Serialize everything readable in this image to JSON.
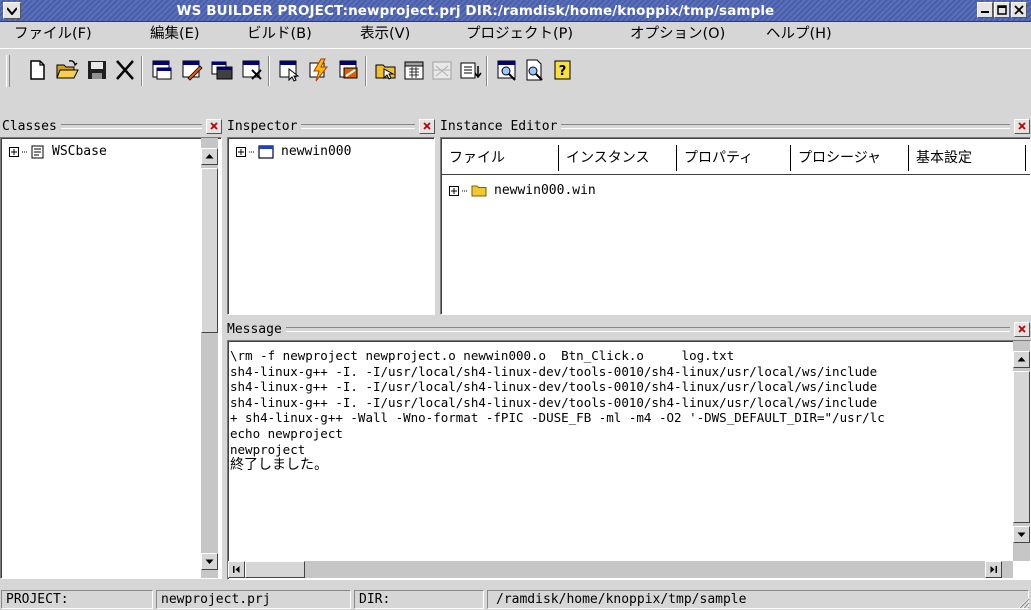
{
  "window": {
    "title": "WS BUILDER PROJECT:newproject.prj DIR:/ramdisk/home/knoppix/tmp/sample"
  },
  "menu": [
    {
      "label": "ファイル(F)"
    },
    {
      "label": "編集(E)"
    },
    {
      "label": "ビルド(B)"
    },
    {
      "label": "表示(V)"
    },
    {
      "label": "プロジェクト(P)"
    },
    {
      "label": "オプション(O)"
    },
    {
      "label": "ヘルプ(H)"
    }
  ],
  "toolbar_icons": [
    "new-file",
    "open-folder",
    "save",
    "delete",
    "dialog-1",
    "dialog-2",
    "dialog-3",
    "dialog-4",
    "dialog-5",
    "lightning",
    "dialog-6",
    "folder-arrow",
    "calendar",
    "gray-grid",
    "list-arrow",
    "find-window",
    "preview",
    "help"
  ],
  "classes_panel": {
    "title": "Classes",
    "items": [
      {
        "label": "WSCbase"
      }
    ]
  },
  "inspector_panel": {
    "title": "Inspector",
    "items": [
      {
        "label": "newwin000"
      }
    ]
  },
  "instance_editor": {
    "title": "Instance Editor",
    "tabs": [
      {
        "label": "ファイル"
      },
      {
        "label": "インスタンス"
      },
      {
        "label": "プロパティ"
      },
      {
        "label": "プロシージャ"
      },
      {
        "label": "基本設定"
      }
    ],
    "items": [
      {
        "label": "newwin000.win"
      }
    ]
  },
  "message_panel": {
    "title": "Message",
    "lines": [
      "\\rm -f newproject newproject.o newwin000.o  Btn_Click.o     log.txt",
      "sh4-linux-g++ -I. -I/usr/local/sh4-linux-dev/tools-0010/sh4-linux/usr/local/ws/include",
      "sh4-linux-g++ -I. -I/usr/local/sh4-linux-dev/tools-0010/sh4-linux/usr/local/ws/include",
      "sh4-linux-g++ -I. -I/usr/local/sh4-linux-dev/tools-0010/sh4-linux/usr/local/ws/include",
      "+ sh4-linux-g++ -Wall -Wno-format -fPIC -DUSE_FB -ml -m4 -O2 '-DWS_DEFAULT_DIR=\"/usr/lc",
      "echo newproject",
      "newproject",
      "終了しました。"
    ]
  },
  "statusbar": {
    "project_label": "PROJECT:",
    "project_value": "newproject.prj",
    "dir_label": "DIR:",
    "dir_value": "/ramdisk/home/knoppix/tmp/sample"
  }
}
